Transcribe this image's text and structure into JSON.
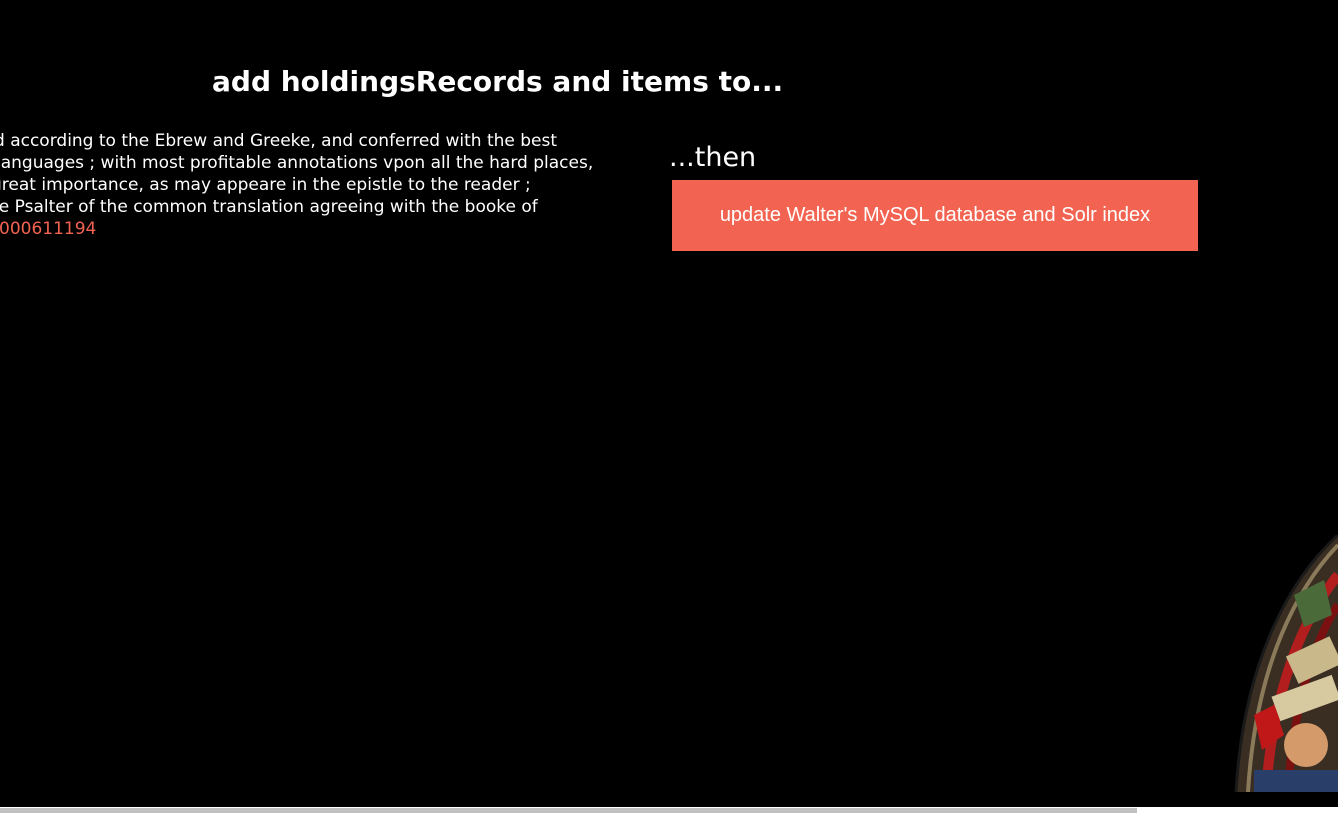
{
  "heading": "add holdingsRecords and items to...",
  "record": {
    "lines": [
      "d according to the Ebrew and Greeke, and conferred with the best",
      "languages ; with most profitable annotations vpon all the hard places,",
      "great importance, as may appeare in the epistle to the reader ;",
      "he Psalter of the common translation agreeing with the booke of"
    ],
    "id": "000611194"
  },
  "then_label": "...then",
  "update_button_label": "update Walter's MySQL database and Solr index",
  "colors": {
    "background": "#000000",
    "accent": "#f26451",
    "text": "#ffffff"
  },
  "decoration": {
    "icon": "stained-glass-window-icon"
  }
}
